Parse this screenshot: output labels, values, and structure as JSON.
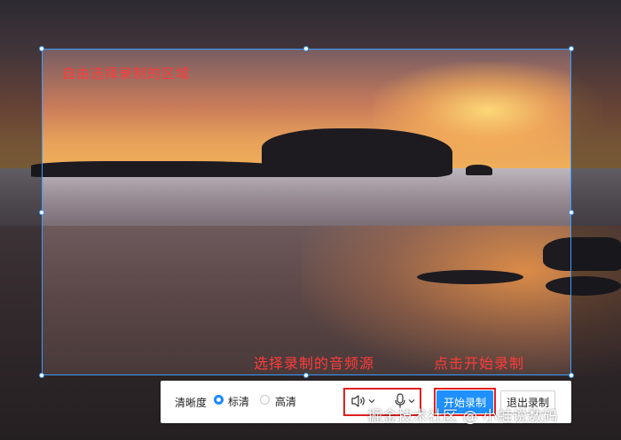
{
  "annotations": {
    "custom_area": "自由选择录制的区域",
    "audio_source": "选择录制的音频源",
    "start_hint": "点击开始录制"
  },
  "toolbar": {
    "clarity_label": "清晰度",
    "options": [
      {
        "label": "标清",
        "selected": true
      },
      {
        "label": "高清",
        "selected": false
      }
    ],
    "speaker_icon": "speaker-icon",
    "mic_icon": "microphone-icon",
    "start_label": "开始录制",
    "exit_label": "退出录制"
  },
  "watermark": "掘金技术社区 @ 小蛙说数码",
  "colors": {
    "selection_border": "#3b9bff",
    "annotation_red": "#ff3b3b",
    "primary_blue": "#1e90ff"
  }
}
